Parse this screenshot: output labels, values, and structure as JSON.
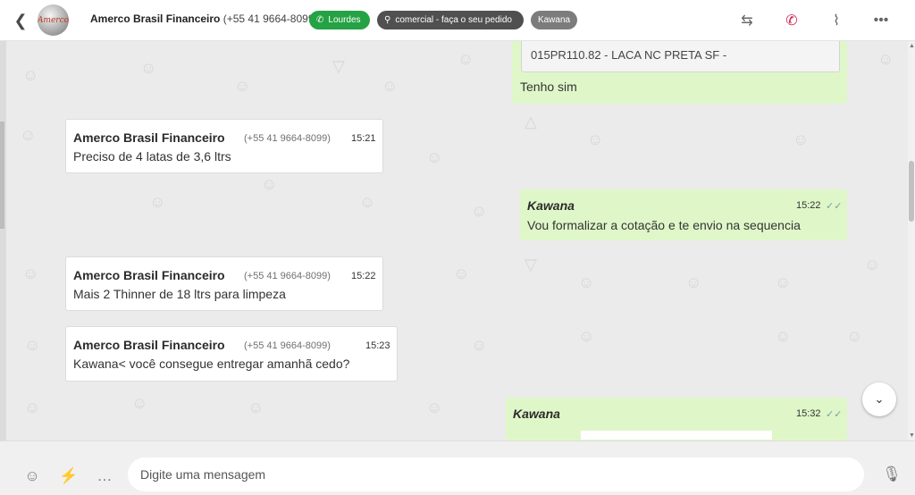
{
  "header": {
    "back_icon": "chevron-left-icon",
    "avatar_text": "Amerco",
    "contact_name": "Amerco Brasil Financeiro",
    "contact_phone": "(+55 41 9664-8099)",
    "tags": [
      {
        "label": "Lourdes",
        "icon": "whatsapp-icon",
        "color": "#25a244"
      },
      {
        "label": "comercial - faça o seu pedido",
        "icon": "sitemap-icon",
        "color": "#505050"
      },
      {
        "label": "Kawana",
        "color": "#7c7c7c"
      }
    ],
    "actions": [
      "transfer-icon",
      "end-call-icon",
      "attach-icon",
      "more-icon"
    ]
  },
  "messages": [
    {
      "direction": "out",
      "quoted_text": "015PR110.82 - LACA NC PRETA SF -",
      "text": "Tenho sim"
    },
    {
      "direction": "in",
      "sender": "Amerco Brasil Financeiro",
      "phone": "(+55 41 9664-8099)",
      "time": "15:21",
      "text": "Preciso de 4 latas de 3,6 ltrs"
    },
    {
      "direction": "out",
      "sender": "Kawana",
      "time": "15:22",
      "text": "Vou formalizar a cotação e te envio na sequencia"
    },
    {
      "direction": "in",
      "sender": "Amerco Brasil Financeiro",
      "phone": "(+55 41 9664-8099)",
      "time": "15:22",
      "text": "Mais 2 Thinner de 18 ltrs para limpeza"
    },
    {
      "direction": "in",
      "sender": "Amerco Brasil Financeiro",
      "phone": "(+55 41 9664-8099)",
      "time": "15:23",
      "text": "Kawana< você consegue entregar amanhã cedo?"
    },
    {
      "direction": "out",
      "sender": "Kawana",
      "time": "15:32",
      "text": ""
    }
  ],
  "composer": {
    "placeholder": "Digite uma mensagem",
    "icons": [
      "emoji-icon",
      "lightning-icon",
      "chat-dots-icon",
      "microphone-icon"
    ]
  },
  "colors": {
    "incoming_bubble": "#ffffff",
    "outgoing_bubble": "#dff7c8",
    "chat_background": "#ebebeb",
    "tag_green": "#25a244"
  }
}
